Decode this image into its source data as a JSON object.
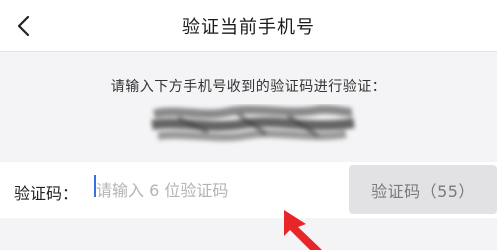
{
  "navbar": {
    "back_icon": "chevron-left-icon",
    "title": "验证当前手机号"
  },
  "main": {
    "instruction": "请输入下方手机号收到的验证码进行验证："
  },
  "verify_row": {
    "label": "验证码：",
    "input_value": "",
    "input_placeholder": "请输入 6 位验证码",
    "resend_button": "验证码（55）"
  },
  "annotation": {
    "arrow_icon": "red-arrow-pointer-icon",
    "arrow_color": "#e8262a"
  },
  "colors": {
    "accent": "#3b6fe0",
    "background": "#f4f4f6",
    "disabled_button_bg": "#e2e2e4"
  }
}
